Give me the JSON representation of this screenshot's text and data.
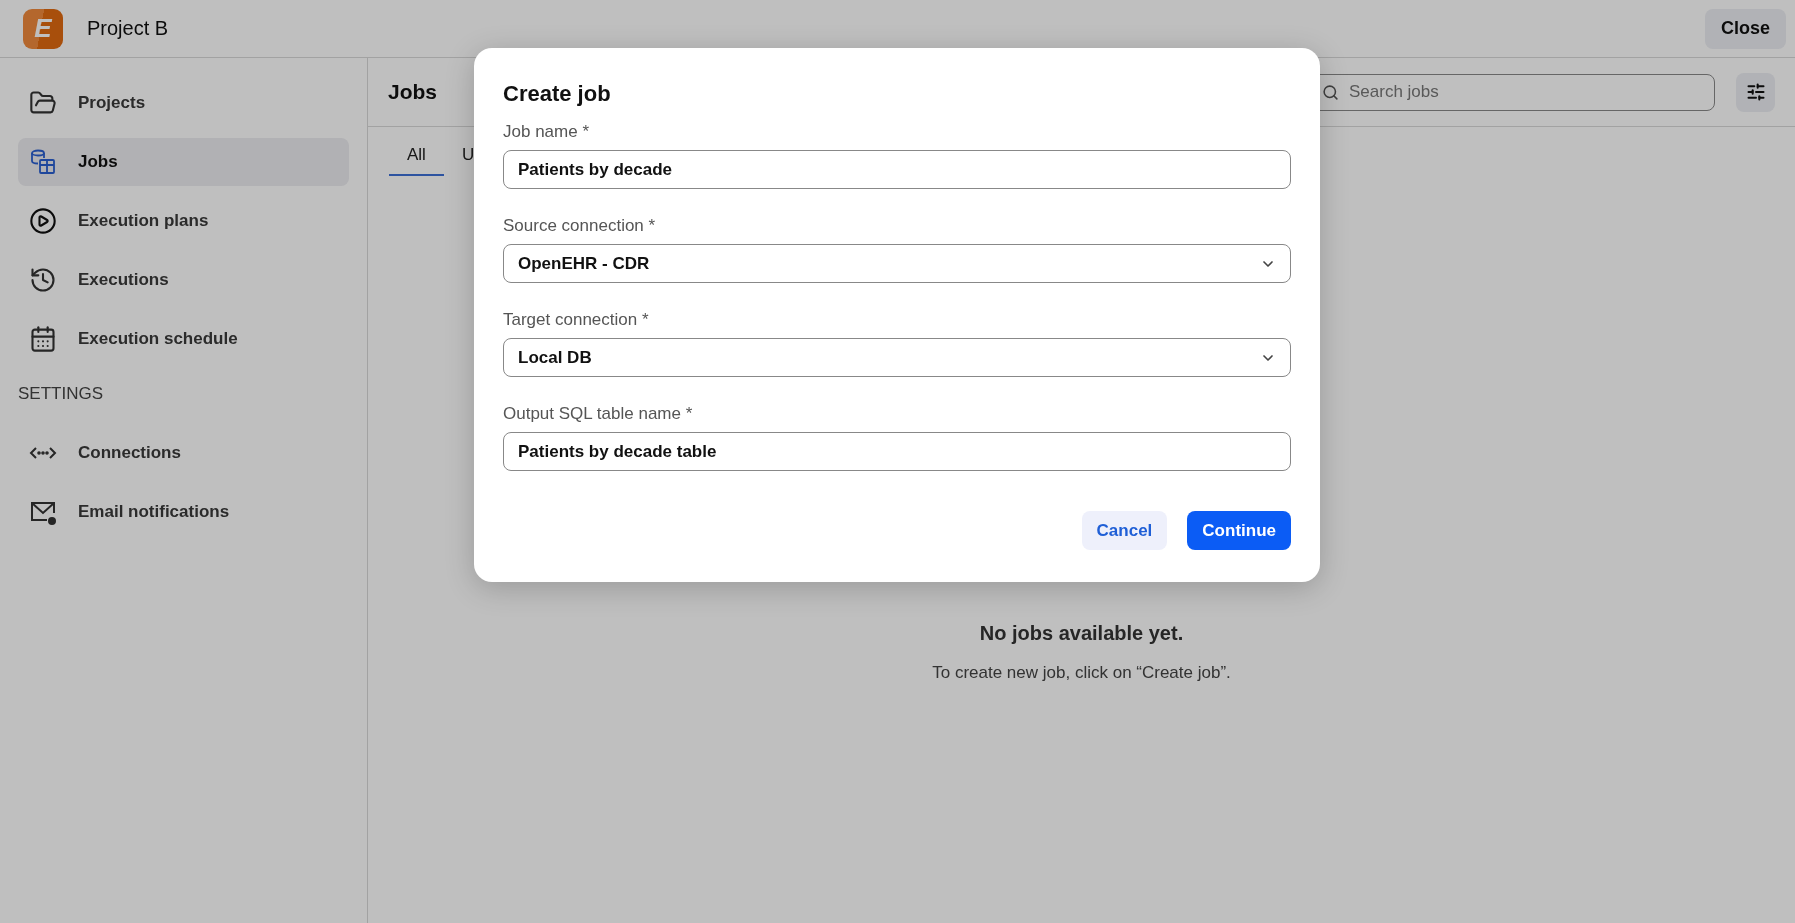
{
  "header": {
    "logo_letter": "E",
    "project": "Project B",
    "close_button": "Close"
  },
  "sidebar": {
    "items": [
      {
        "label": "Projects",
        "kind": "folder",
        "selected": false
      },
      {
        "label": "Jobs",
        "kind": "jobs",
        "selected": true
      },
      {
        "label": "Execution plans",
        "kind": "play",
        "selected": false
      },
      {
        "label": "Executions",
        "kind": "history",
        "selected": false
      },
      {
        "label": "Execution schedule",
        "kind": "calendar",
        "selected": false
      }
    ],
    "section": "SETTINGS",
    "settings_items": [
      {
        "label": "Connections",
        "kind": "connections",
        "selected": false
      },
      {
        "label": "Email notifications",
        "kind": "mail",
        "selected": false
      }
    ]
  },
  "main": {
    "title": "Jobs",
    "search": {
      "placeholder": "Search jobs"
    },
    "tabs": [
      {
        "label": "All",
        "selected": true
      },
      {
        "label": "U",
        "selected": false
      }
    ],
    "empty": {
      "title": "No jobs available yet.",
      "text": "To create new job, click on “Create job”."
    }
  },
  "modal": {
    "title": "Create job",
    "fields": [
      {
        "label": "Job name *",
        "kind": "text",
        "value": "Patients by decade"
      },
      {
        "label": "Source connection *",
        "kind": "select",
        "value": "OpenEHR - CDR"
      },
      {
        "label": "Target connection *",
        "kind": "select",
        "value": "Local DB"
      },
      {
        "label": "Output SQL table name *",
        "kind": "text",
        "value": "Patients by decade table"
      }
    ],
    "buttons": [
      {
        "label": "Cancel",
        "kind": "secondary"
      },
      {
        "label": "Continue",
        "kind": "primary"
      }
    ]
  }
}
